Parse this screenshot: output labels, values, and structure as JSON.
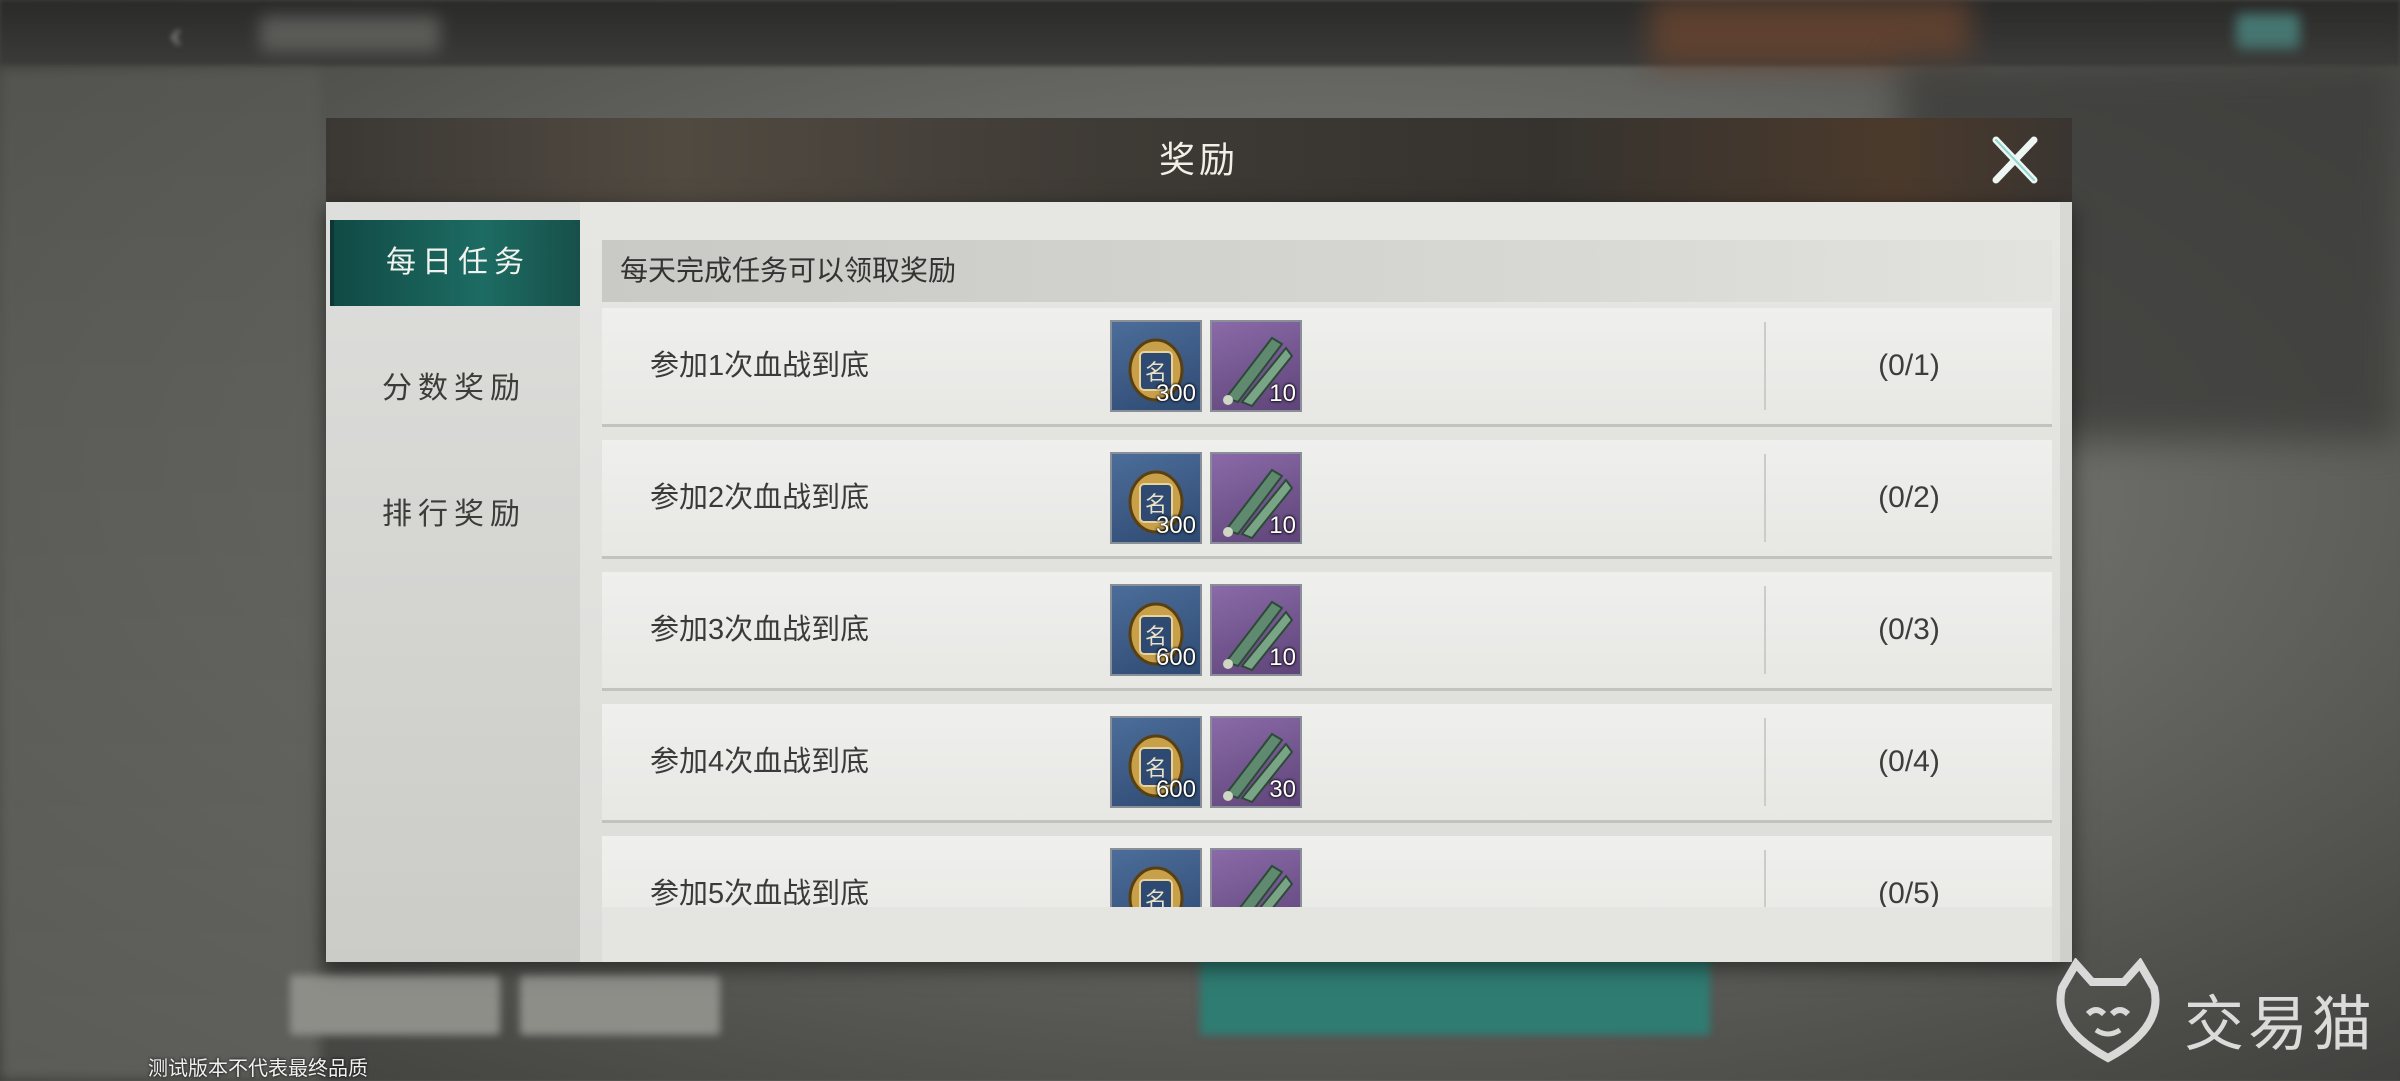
{
  "modal": {
    "title": "奖励"
  },
  "tabs": [
    {
      "label": "每日任务",
      "active": true
    },
    {
      "label": "分数奖励",
      "active": false
    },
    {
      "label": "排行奖励",
      "active": false
    }
  ],
  "notice": "每天完成任务可以领取奖励",
  "tasks": [
    {
      "label": "参加1次血战到底",
      "reward1": {
        "icon": "name-token-icon",
        "count": "300"
      },
      "reward2": {
        "icon": "green-blade-icon",
        "count": "10"
      },
      "progress": "(0/1)"
    },
    {
      "label": "参加2次血战到底",
      "reward1": {
        "icon": "name-token-icon",
        "count": "300"
      },
      "reward2": {
        "icon": "green-blade-icon",
        "count": "10"
      },
      "progress": "(0/2)"
    },
    {
      "label": "参加3次血战到底",
      "reward1": {
        "icon": "name-token-icon",
        "count": "600"
      },
      "reward2": {
        "icon": "green-blade-icon",
        "count": "10"
      },
      "progress": "(0/3)"
    },
    {
      "label": "参加4次血战到底",
      "reward1": {
        "icon": "name-token-icon",
        "count": "600"
      },
      "reward2": {
        "icon": "green-blade-icon",
        "count": "30"
      },
      "progress": "(0/4)"
    },
    {
      "label": "参加5次血战到底",
      "reward1": {
        "icon": "name-token-icon",
        "count": ""
      },
      "reward2": {
        "icon": "green-blade-icon",
        "count": ""
      },
      "progress": "(0/5)"
    }
  ],
  "footer": {
    "test_notice": "测试版本不代表最终品质"
  },
  "brand": {
    "name": "交易猫"
  },
  "colors": {
    "active_tab": "#1c6c63",
    "header": "#3b3834",
    "reward_blue": "#2e4a72",
    "reward_purple": "#5e4478"
  }
}
